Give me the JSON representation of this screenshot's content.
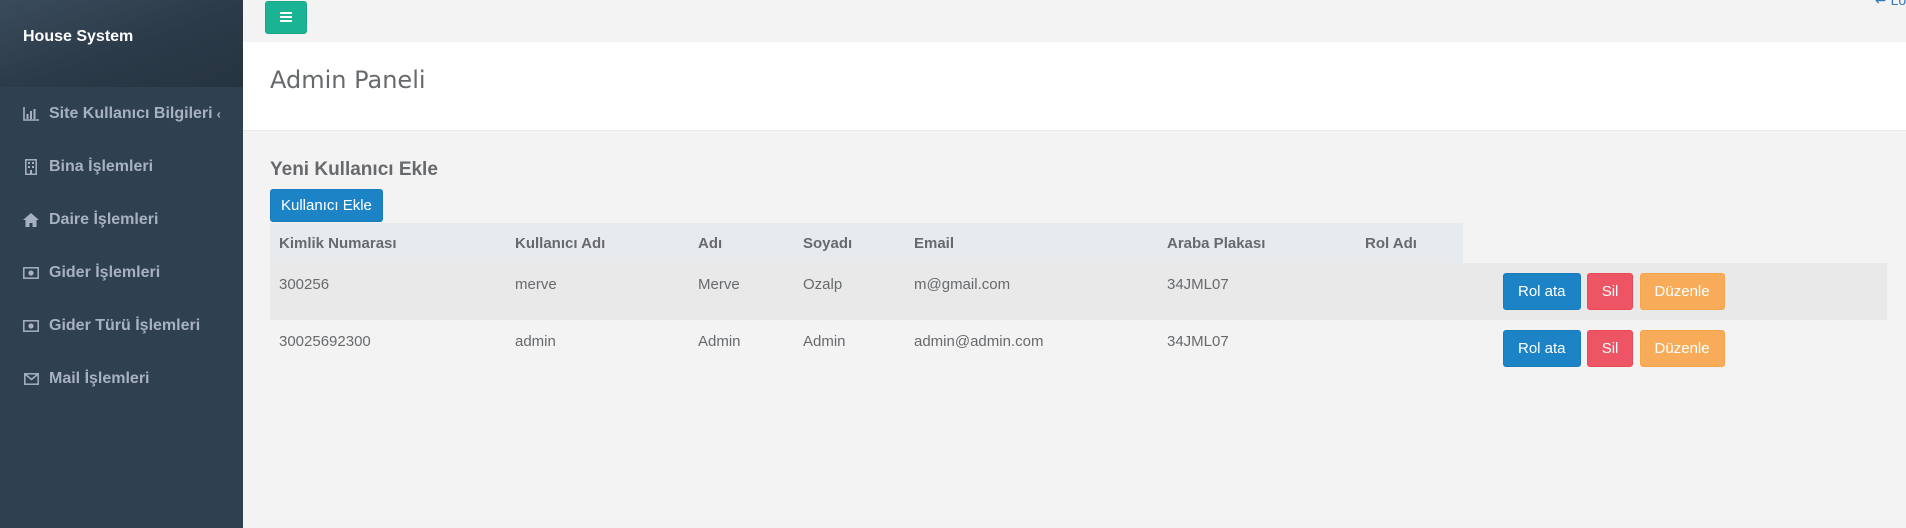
{
  "app": {
    "brand": "House System"
  },
  "sidebar": {
    "items": [
      {
        "label": "Site Kullanıcı Bilgileri",
        "icon": "bar-chart-icon",
        "has_arrow": true
      },
      {
        "label": "Bina İşlemleri",
        "icon": "building-icon"
      },
      {
        "label": "Daire İşlemleri",
        "icon": "home-icon"
      },
      {
        "label": "Gider İşlemleri",
        "icon": "money-icon"
      },
      {
        "label": "Gider Türü İşlemleri",
        "icon": "money-icon"
      },
      {
        "label": "Mail İşlemleri",
        "icon": "envelope-icon"
      }
    ],
    "arrow": "‹"
  },
  "topbar": {
    "logout_label": "Log"
  },
  "page": {
    "title": "Admin Paneli",
    "section_title": "Yeni Kullanıcı Ekle",
    "add_button": "Kullanıcı Ekle"
  },
  "table": {
    "headers": [
      "Kimlik Numarası",
      "Kullanıcı Adı",
      "Adı",
      "Soyadı",
      "Email",
      "Araba Plakası",
      "Rol Adı"
    ],
    "rows": [
      {
        "id": "300256",
        "username": "merve",
        "name": "Merve",
        "surname": "Ozalp",
        "email": "m@gmail.com",
        "plate": "34JML07",
        "role": ""
      },
      {
        "id": "30025692300",
        "username": "admin",
        "name": "Admin",
        "surname": "Admin",
        "email": "admin@admin.com",
        "plate": "34JML07",
        "role": ""
      }
    ],
    "actions": {
      "assign_role": "Rol ata",
      "delete": "Sil",
      "edit": "Düzenle"
    }
  },
  "colors": {
    "sidebar_bg": "#2f4050",
    "accent_green": "#1ab394",
    "primary_blue": "#1c84c6",
    "danger_red": "#ed5565",
    "warning_orange": "#f8ac59"
  }
}
